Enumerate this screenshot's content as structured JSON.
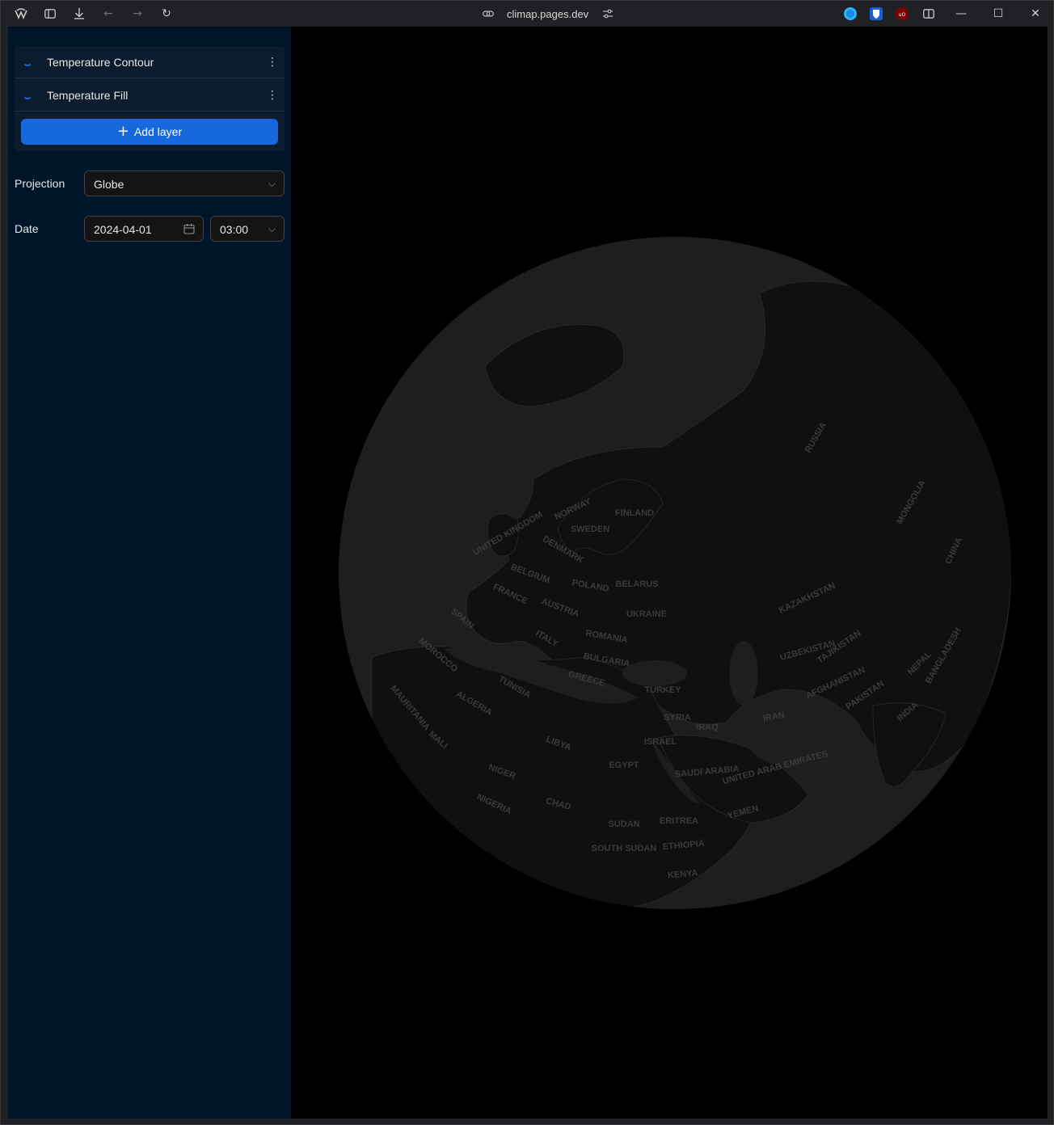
{
  "browser": {
    "url": "climap.pages.dev"
  },
  "layers": [
    {
      "name": "Temperature Contour"
    },
    {
      "name": "Temperature Fill"
    }
  ],
  "add_layer_label": "Add layer",
  "projection": {
    "label": "Projection",
    "value": "Globe"
  },
  "date": {
    "label": "Date",
    "value": "2024-04-01",
    "time": "03:00"
  },
  "map_labels": [
    "UNITED KINGDOM",
    "NORWAY",
    "SWEDEN",
    "FINLAND",
    "DENMARK",
    "BELGIUM",
    "FRANCE",
    "POLAND",
    "BELARUS",
    "AUSTRIA",
    "UKRAINE",
    "SPAIN",
    "ITALY",
    "ROMANIA",
    "BULGARIA",
    "GREECE",
    "MOROCCO",
    "TUNISIA",
    "TURKEY",
    "ALGERIA",
    "MAURITANIA",
    "MALI",
    "NIGER",
    "LIBYA",
    "EGYPT",
    "SYRIA",
    "IRAQ",
    "ISRAEL",
    "IRAN",
    "SAUDI ARABIA",
    "UNITED ARAB EMIRATES",
    "YEMEN",
    "CHAD",
    "NIGERIA",
    "SUDAN",
    "ERITREA",
    "SOUTH SUDAN",
    "ETHIOPIA",
    "KENYA",
    "KAZAKHSTAN",
    "UZBEKISTAN",
    "TAJIKISTAN",
    "AFGHANISTAN",
    "PAKISTAN",
    "NEPAL",
    "BANGLADESH",
    "INDIA",
    "CHINA",
    "MONGOLIA",
    "RUSSIA"
  ]
}
